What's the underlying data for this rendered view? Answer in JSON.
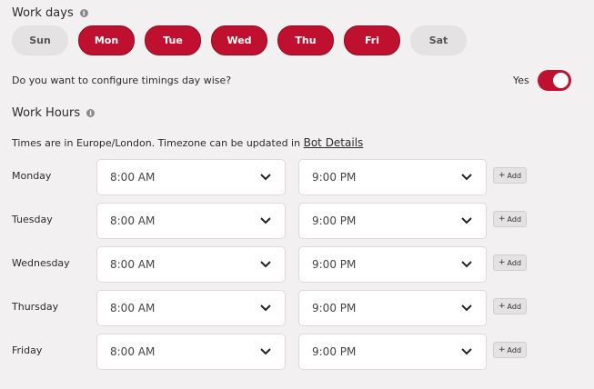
{
  "work_days": {
    "title": "Work days",
    "days": [
      {
        "label": "Sun",
        "selected": false
      },
      {
        "label": "Mon",
        "selected": true
      },
      {
        "label": "Tue",
        "selected": true
      },
      {
        "label": "Wed",
        "selected": true
      },
      {
        "label": "Thu",
        "selected": true
      },
      {
        "label": "Fri",
        "selected": true
      },
      {
        "label": "Sat",
        "selected": false
      }
    ]
  },
  "day_wise": {
    "question": "Do you want to configure timings day wise?",
    "toggle_label": "Yes",
    "toggle_on": true
  },
  "work_hours": {
    "title": "Work Hours",
    "timezone_note": "Times are in Europe/London. Timezone can be updated in ",
    "timezone_link": "Bot Details",
    "add_label": "Add",
    "rows": [
      {
        "day": "Monday",
        "start": "8:00 AM",
        "end": "9:00 PM"
      },
      {
        "day": "Tuesday",
        "start": "8:00 AM",
        "end": "9:00 PM"
      },
      {
        "day": "Wednesday",
        "start": "8:00 AM",
        "end": "9:00 PM"
      },
      {
        "day": "Thursday",
        "start": "8:00 AM",
        "end": "9:00 PM"
      },
      {
        "day": "Friday",
        "start": "8:00 AM",
        "end": "9:00 PM"
      }
    ]
  },
  "colors": {
    "accent": "#c0102f",
    "background": "#f2f0f1",
    "unselected": "#e4e2e3"
  },
  "icons": {
    "info": "info-icon",
    "dropdown": "chevron-down-icon",
    "add": "plus-icon"
  }
}
